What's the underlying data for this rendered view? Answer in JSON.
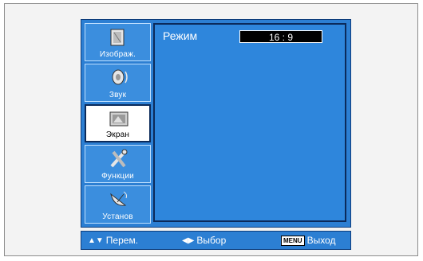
{
  "sidebar": {
    "items": [
      {
        "label": "Изображ.",
        "icon": "picture-icon",
        "selected": false
      },
      {
        "label": "Звук",
        "icon": "speaker-icon",
        "selected": false
      },
      {
        "label": "Экран",
        "icon": "screen-icon",
        "selected": true
      },
      {
        "label": "Функции",
        "icon": "tools-icon",
        "selected": false
      },
      {
        "label": "Установ",
        "icon": "satellite-dish-icon",
        "selected": false
      }
    ]
  },
  "content": {
    "mode_label": "Режим",
    "mode_value": "16 : 9"
  },
  "footer": {
    "move_label": "Перем.",
    "select_label": "Выбор",
    "menu_key": "MENU",
    "exit_label": "Выход"
  },
  "colors": {
    "osd_background": "#2c7fd3",
    "osd_border": "#0b2a5a",
    "selected_item": "#ffffff"
  }
}
